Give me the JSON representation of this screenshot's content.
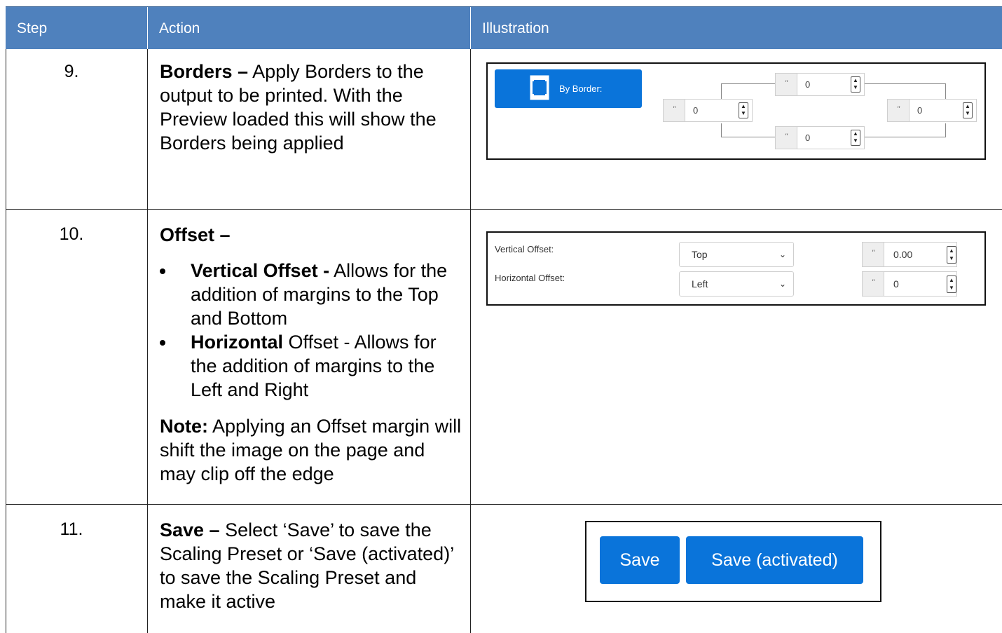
{
  "header": {
    "step": "Step",
    "action": "Action",
    "illustration": "Illustration"
  },
  "rows": [
    {
      "step": "9.",
      "title": "Borders –",
      "text": " Apply Borders to the output to be printed. With the Preview loaded this will show the Borders being applied"
    },
    {
      "step": "10.",
      "title": "Offset –",
      "bullets": [
        {
          "bold": "Vertical Offset -",
          "text": " Allows for the addition of margins to the Top and Bottom"
        },
        {
          "bold": "Horizontal",
          "text": " Offset - Allows for the addition of margins to the Left and Right"
        }
      ],
      "note_bold": "Note:",
      "note_text": " Applying an Offset margin will shift the image on the page and may clip off the edge"
    },
    {
      "step": "11.",
      "title": "Save –",
      "text": " Select ‘Save’ to save the Scaling Preset or ‘Save (activated)’ to save the Scaling Preset and make it active"
    }
  ],
  "border_ui": {
    "button_label": "By Border:",
    "unit": "\"",
    "top": "0",
    "left": "0",
    "right": "0",
    "bottom": "0"
  },
  "offset_ui": {
    "vertical_label": "Vertical Offset:",
    "vertical_select": "Top",
    "vertical_value": "0.00",
    "horizontal_label": "Horizontal Offset:",
    "horizontal_select": "Left",
    "horizontal_value": "0",
    "unit": "\""
  },
  "save_ui": {
    "save_label": "Save",
    "save_activated_label": "Save (activated)"
  },
  "colors": {
    "header_bg": "#4f81bd",
    "button_blue": "#0a74da"
  }
}
